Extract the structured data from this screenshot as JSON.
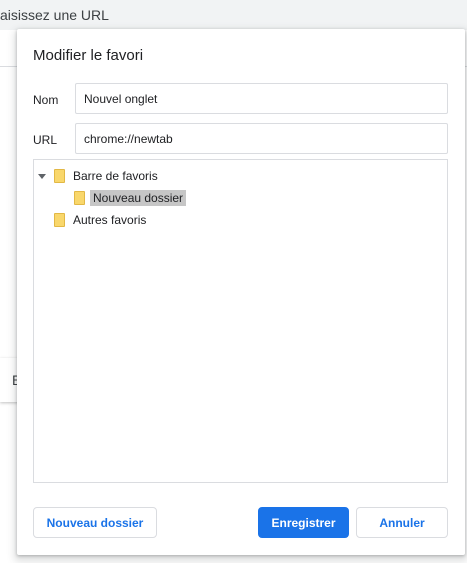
{
  "background": {
    "omnibox_text": "aisissez une URL",
    "left_card_letter": "E"
  },
  "dialog": {
    "title": "Modifier le favori",
    "name_label": "Nom",
    "name_value": "Nouvel onglet",
    "url_label": "URL",
    "url_value": "chrome://newtab",
    "tree": [
      {
        "label": "Barre de favoris",
        "expanded": true,
        "selected": false
      },
      {
        "label": "Nouveau dossier",
        "expanded": false,
        "selected": true
      },
      {
        "label": "Autres favoris",
        "expanded": false,
        "selected": false
      }
    ],
    "buttons": {
      "new_folder": "Nouveau dossier",
      "save": "Enregistrer",
      "cancel": "Annuler"
    }
  },
  "colors": {
    "accent": "#1a73e8",
    "folder": "#f9d76b",
    "selection": "#c6c6c6"
  },
  "icons": {
    "expand_arrow": "triangle-down-icon",
    "folder": "folder-icon"
  }
}
